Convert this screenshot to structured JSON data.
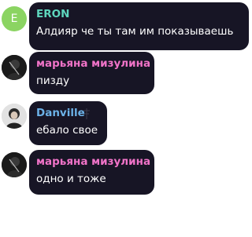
{
  "colors": {
    "bubble_bg": "#171525",
    "message_text": "#ffffff",
    "avatar_e_bg": "#8bd462"
  },
  "messages": [
    {
      "avatar_letter": "E",
      "sender": "ERON",
      "sender_color": "#5ed6bd",
      "text": "Алдияр че ты там им показываешь"
    },
    {
      "sender": "марьяна мизулина",
      "sender_color": "#f073c8",
      "text": "пизду"
    },
    {
      "sender": "Danville",
      "sender_color": "#6cb2e8",
      "text": "ебало свое"
    },
    {
      "sender": "марьяна мизулина",
      "sender_color": "#f073c8",
      "text": "одно и тоже"
    }
  ]
}
